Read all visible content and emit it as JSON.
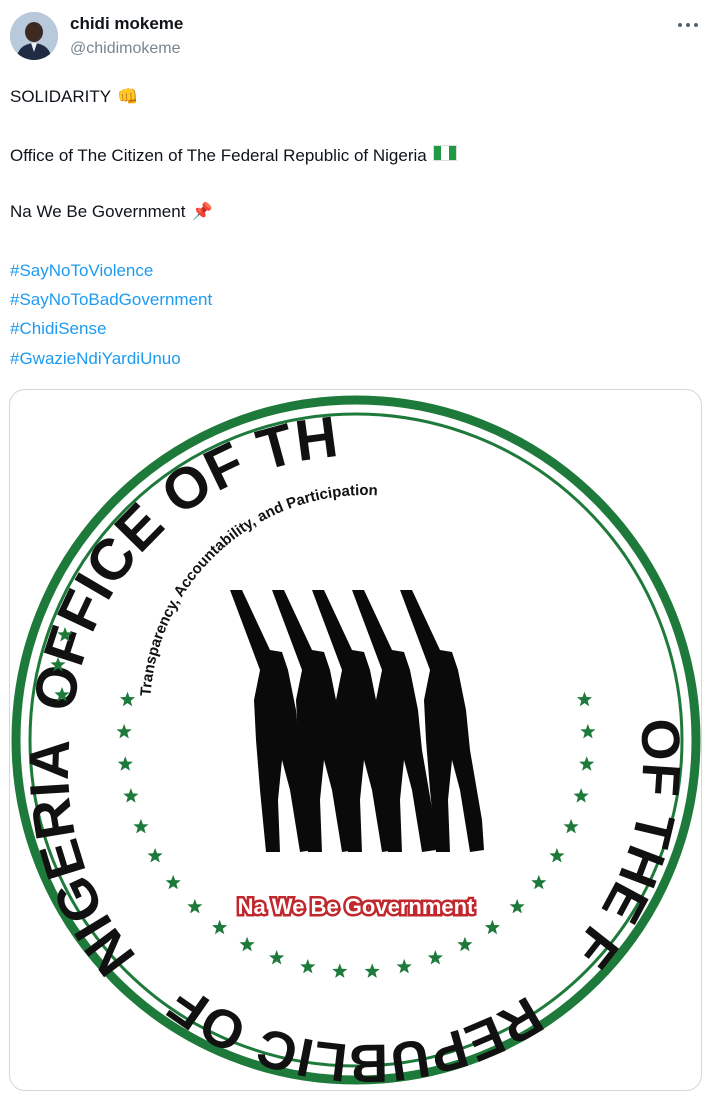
{
  "author": {
    "display_name": "chidi mokeme",
    "handle": "@chidimokeme",
    "avatar_icon": "avatar-photo"
  },
  "actions": {
    "more_icon": "more-dots-icon"
  },
  "post": {
    "line1": "SOLIDARITY",
    "line1_emoji": "👊",
    "line2": "Office of The Citizen of The Federal Republic of Nigeria",
    "line2_emoji": "nigeria-flag",
    "line3": "Na We Be Government",
    "line3_emoji": "📌",
    "hashtags": [
      "#SayNoToViolence",
      "#SayNoToBadGovernment",
      "#ChidiSense",
      "#GwazieNdiYardiUnuo"
    ]
  },
  "media": {
    "seal": {
      "outer_top": "OFFICE OF THE CITIZEN",
      "outer_right": "OF THE FEDERAL",
      "outer_bottom": "REPUBLIC OF",
      "outer_left": "NIGERIA",
      "inner_arc": "Transparency, Accountability, and Participation",
      "slogan": "Na We Be Government"
    },
    "colors": {
      "ring_green": "#1e7a3a",
      "star_green": "#1e7a3a",
      "slogan_red": "#c0282d",
      "figure_black": "#0a0a0a"
    }
  },
  "colors": {
    "hashtag": "#1d9bf0",
    "text": "#0f1419",
    "handle": "#7a868f"
  }
}
